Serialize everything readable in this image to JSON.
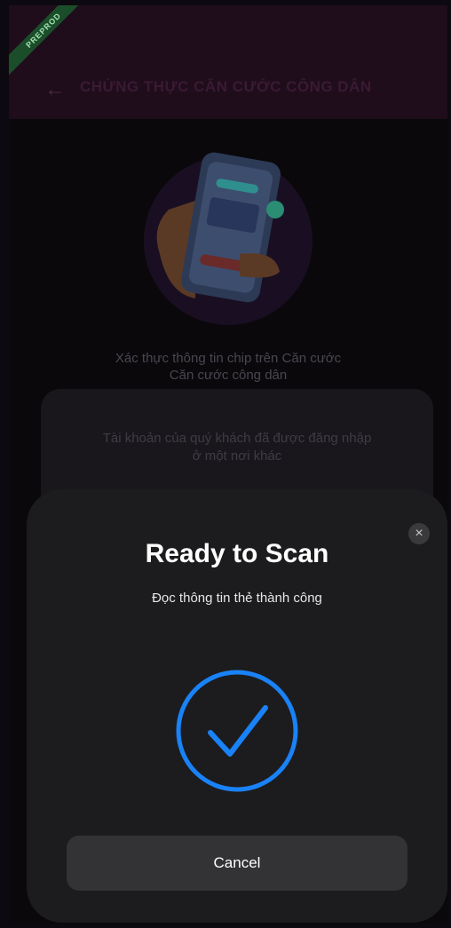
{
  "app_bar": {
    "env_badge": "PREPROD",
    "title": "CHỨNG THỰC CĂN CƯỚC CÔNG DÂN",
    "back_icon": "arrow-left-icon"
  },
  "background": {
    "title_line1": "Xác thực thông tin chip trên Căn cước",
    "title_line2": "Căn cước công dân",
    "message_line1": "Tài khoản của quý khách đã được đăng nhập",
    "message_line2": "ở một nơi khác"
  },
  "scan_sheet": {
    "title": "Ready to Scan",
    "subtitle": "Đọc thông tin thẻ thành công",
    "close_icon": "close-icon",
    "status_icon": "checkmark-circle-icon",
    "cancel_label": "Cancel",
    "accent_color": "#1a82f7"
  }
}
